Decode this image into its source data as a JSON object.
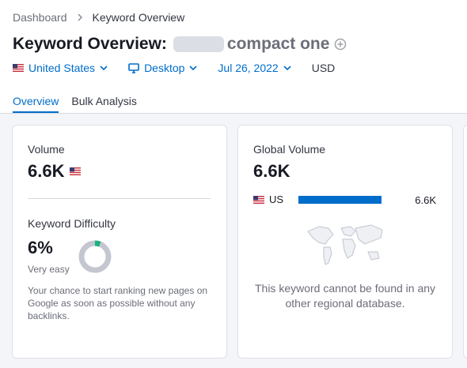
{
  "breadcrumb": {
    "home": "Dashboard",
    "current": "Keyword Overview"
  },
  "title": {
    "prefix": "Keyword Overview:",
    "keyword_suffix": "compact one"
  },
  "filters": {
    "country": "United States",
    "device": "Desktop",
    "date": "Jul 26, 2022",
    "currency": "USD"
  },
  "tabs": [
    {
      "label": "Overview",
      "active": true
    },
    {
      "label": "Bulk Analysis",
      "active": false
    }
  ],
  "volume": {
    "label": "Volume",
    "value": "6.6K"
  },
  "difficulty": {
    "label": "Keyword Difficulty",
    "value": "6%",
    "percent": 6,
    "level": "Very easy",
    "description": "Your chance to start ranking new pages on Google as soon as possible without any backlinks."
  },
  "global_volume": {
    "label": "Global Volume",
    "value": "6.6K",
    "countries": [
      {
        "code": "US",
        "value": "6.6K",
        "share": 1.0
      }
    ],
    "empty_message": "This keyword cannot be found in any other regional database."
  },
  "colors": {
    "accent": "#006dca",
    "difficulty_ring": "#1bb27e",
    "ring_track": "#c4c7d0",
    "text": "#171a22",
    "muted": "#6c6e79"
  },
  "icons": {
    "breadcrumb_sep": "chevron-right-icon",
    "add": "plus-circle-icon",
    "country": "us-flag-icon",
    "device": "desktop-icon",
    "dropdown": "chevron-down-icon",
    "map": "world-map-icon"
  }
}
